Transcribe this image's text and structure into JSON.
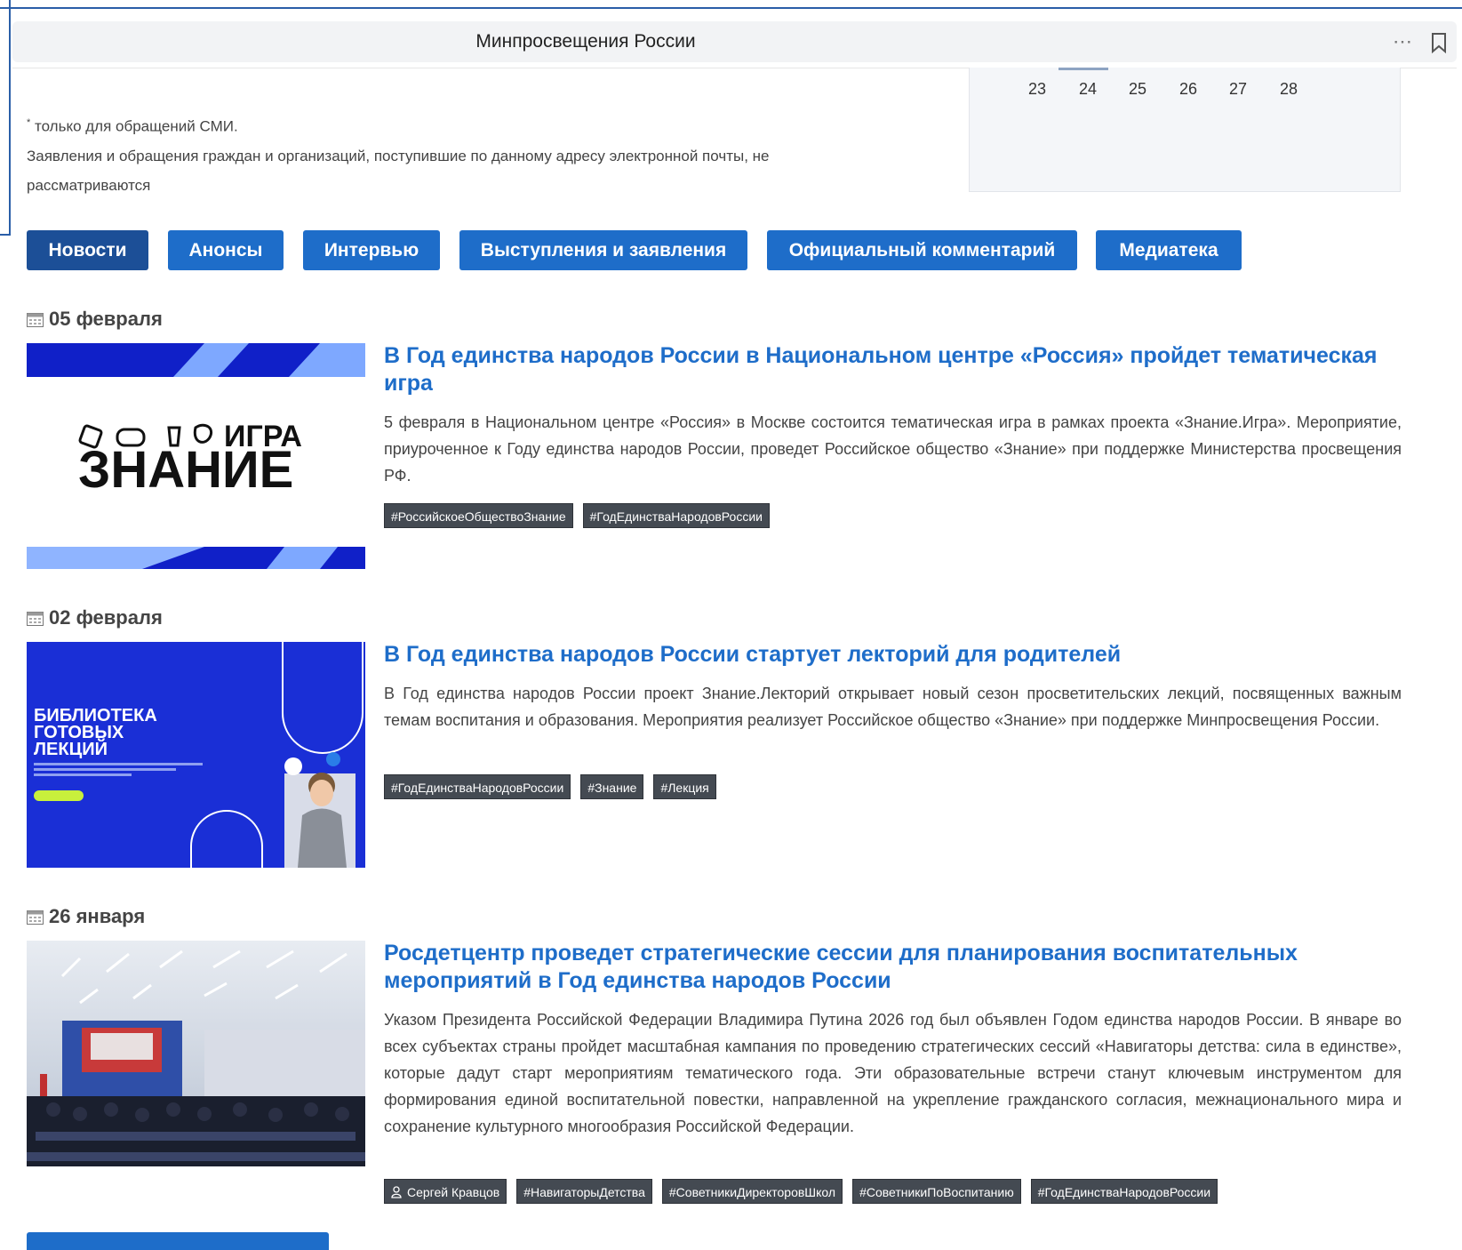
{
  "browser": {
    "tab_title": "Минпросвещения России",
    "menu_icon": "ellipsis-icon",
    "bookmark_icon": "bookmark-icon"
  },
  "contacts_note": {
    "asterisk": "*",
    "line1": " только для обращений СМИ.",
    "line2": "Заявления и обращения граждан и организаций, поступившие по данному адресу электронной почты, не",
    "line3": "рассматриваются"
  },
  "calendar": {
    "visible_days": [
      "23",
      "24",
      "25",
      "26",
      "27",
      "28"
    ],
    "highlighted_day": "24"
  },
  "tabs": [
    {
      "label": "Новости",
      "active": true
    },
    {
      "label": "Анонсы",
      "active": false
    },
    {
      "label": "Интервью",
      "active": false
    },
    {
      "label": "Выступления и заявления",
      "active": false
    },
    {
      "label": "Официальный комментарий",
      "active": false
    },
    {
      "label": "Медиатека",
      "active": false
    }
  ],
  "news": [
    {
      "date": "05 февраля",
      "title": "В Год единства народов России в Национальном центре «Россия» пройдет тематическая игра",
      "text": "5 февраля в Национальном центре «Россия» в Москве состоится тематическая игра в рамках проекта «Знание.Игра». Мероприятие, приуроченное к Году единства народов России, проведет Российское общество «Знание» при поддержке Министерства просвещения РФ.",
      "image_text": {
        "line1": "ИГРА",
        "line2": "ЗНАНИЕ"
      },
      "tags": [
        "#РоссийскоеОбществоЗнание",
        "#ГодЕдинстваНародовРоссии"
      ]
    },
    {
      "date": "02 февраля",
      "title": "В Год единства народов России стартует лекторий для родителей",
      "text": "В Год единства народов России проект Знание.Лекторий открывает новый сезон просветительских лекций, посвященных важным темам воспитания и образования. Мероприятия реализует Российское общество «Знание» при поддержке Минпросвещения России.",
      "image_text": {
        "line1": "БИБЛИОТЕКА",
        "line2": "ГОТОВЫХ",
        "line3": "ЛЕКЦИЙ"
      },
      "tags": [
        "#ГодЕдинстваНародовРоссии",
        "#Знание",
        "#Лекция"
      ]
    },
    {
      "date": "26 января",
      "title": "Росдетцентр проведет стратегические сессии для планирования воспитательных мероприятий в Год единства народов России",
      "text": "Указом Президента Российской Федерации Владимира Путина 2026 год был объявлен Годом единства народов России. В январе во всех субъектах страны пройдет масштабная кампания по проведению стратегических сессий «Навигаторы детства: сила в единстве», которые дадут старт мероприятиям тематического года. Эти образовательные встречи станут ключевым инструментом для формирования единой воспитательной повестки, направленной на укрепление гражданского согласия, межнационального мира и сохранение культурного многообразия Российской Федерации.",
      "author": "Сергей Кравцов",
      "tags": [
        "#НавигаторыДетства",
        "#СоветникиДиректоровШкол",
        "#СоветникиПоВоспитанию",
        "#ГодЕдинстваНародовРоссии"
      ]
    }
  ],
  "colors": {
    "accent": "#1e6dc9",
    "active_tab": "#1c4f97",
    "tag_bg": "#444a52",
    "brand_blue": "#1020c8"
  }
}
